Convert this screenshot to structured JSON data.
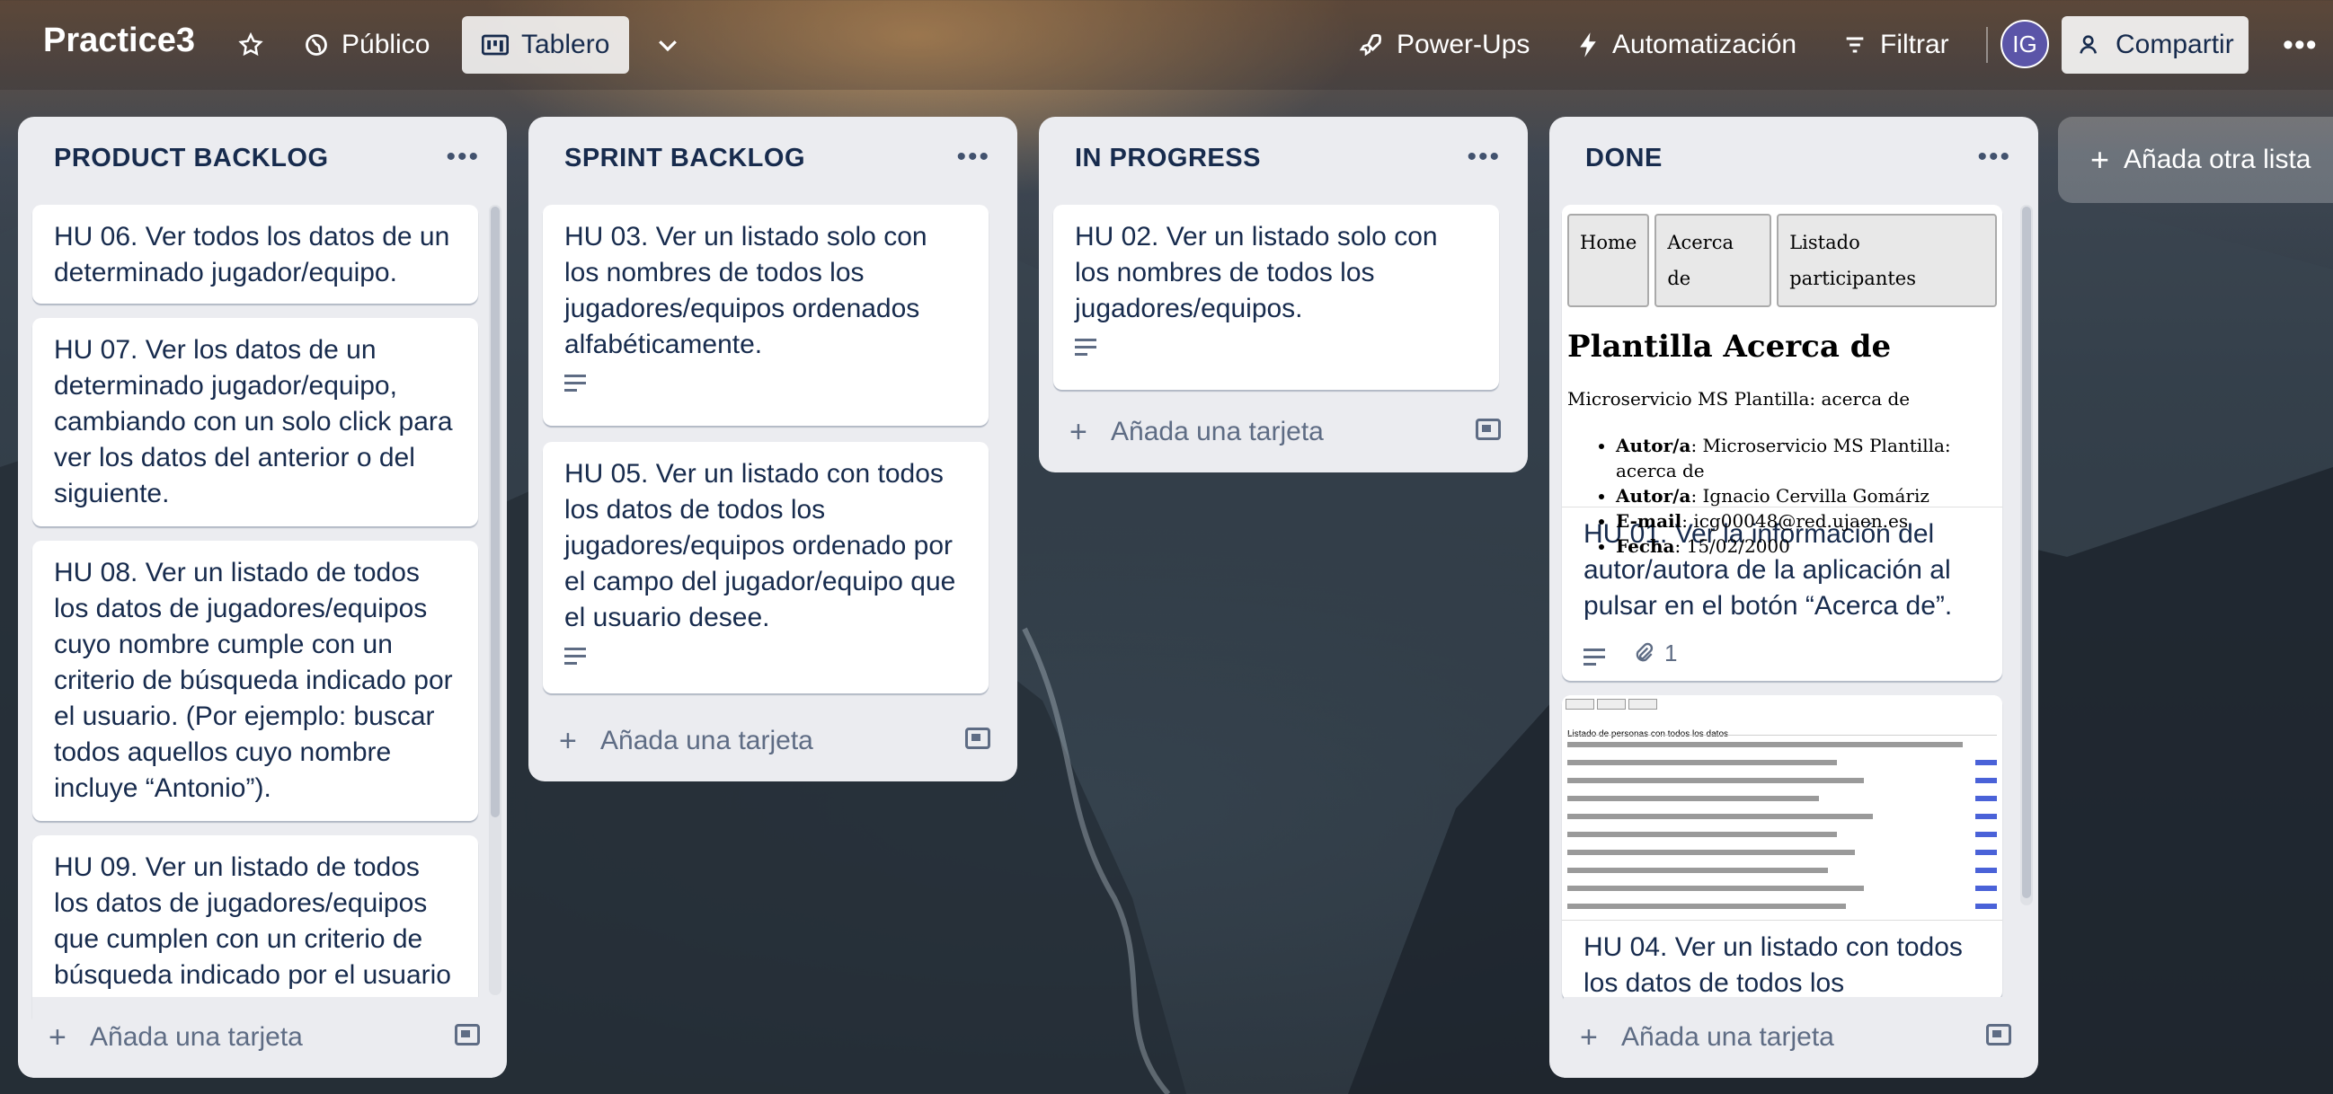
{
  "header": {
    "board_title": "Practice3",
    "visibility_label": "Público",
    "view_label": "Tablero",
    "powerups_label": "Power-Ups",
    "automation_label": "Automatización",
    "filter_label": "Filtrar",
    "avatar_initials": "IG",
    "share_label": "Compartir"
  },
  "lists": [
    {
      "title": "PRODUCT BACKLOG",
      "cards": [
        "HU 06. Ver todos los datos de un determinado jugador/equipo.",
        "HU 07. Ver los datos de un determinado jugador/equipo, cambiando con un solo click para ver los datos del anterior o del siguiente.",
        "HU 08. Ver un listado de todos los datos de jugadores/equipos cuyo nombre cumple con un criterio de búsqueda indicado por el usuario. (Por ejemplo: buscar todos aquellos cuyo nombre incluye “Antonio”).",
        "HU 09. Ver un listado de todos los datos de jugadores/equipos que cumplen con un criterio de búsqueda indicado por el usuario"
      ],
      "add_card_label": "Añada una tarjeta"
    },
    {
      "title": "SPRINT BACKLOG",
      "cards": [
        "HU 03. Ver un listado solo con los nombres de todos los jugadores/equipos ordenados alfabéticamente.",
        "HU 05. Ver un listado con todos los datos de todos los jugadores/equipos ordenado por el campo del jugador/equipo que el usuario desee."
      ],
      "add_card_label": "Añada una tarjeta"
    },
    {
      "title": "IN PROGRESS",
      "cards": [
        "HU 02. Ver un listado solo con los nombres de todos los jugadores/equipos."
      ],
      "add_card_label": "Añada una tarjeta"
    },
    {
      "title": "DONE",
      "cards": [
        "HU 01. Ver la información del autor/autora de la aplicación al pulsar en el botón “Acerca de”.",
        "HU 04. Ver un listado con todos los datos de todos los"
      ],
      "attachment_count": "1",
      "add_card_label": "Añada una tarjeta",
      "cover": {
        "tabs": [
          "Home",
          "Acerca de",
          "Listado participantes"
        ],
        "heading": "Plantilla Acerca de",
        "subtitle": "Microservicio MS Plantilla: acerca de",
        "items": [
          {
            "key": "Autor/a",
            "value": ": Microservicio MS Plantilla: acerca de"
          },
          {
            "key": "Autor/a",
            "value": ": Ignacio Cervilla Gomáriz"
          },
          {
            "key": "E-mail",
            "value": ": icg00048@red.ujaen.es"
          },
          {
            "key": "Fecha",
            "value": ": 15/02/2000"
          }
        ],
        "table_title": "Listado de personas con todos los datos"
      }
    }
  ],
  "add_list_label": "Añada otra lista",
  "icons": [
    "star-icon",
    "globe-icon",
    "board-icon",
    "chevron-down-icon",
    "rocket-icon",
    "bolt-icon",
    "filter-icon",
    "add-person-icon",
    "more-icon",
    "plus-icon",
    "template-icon",
    "description-icon",
    "paperclip-icon"
  ],
  "colors": {
    "list_bg": "#ebecf0",
    "text": "#172b4d",
    "muted": "#5e6c84",
    "avatar": "#5b55a8"
  }
}
